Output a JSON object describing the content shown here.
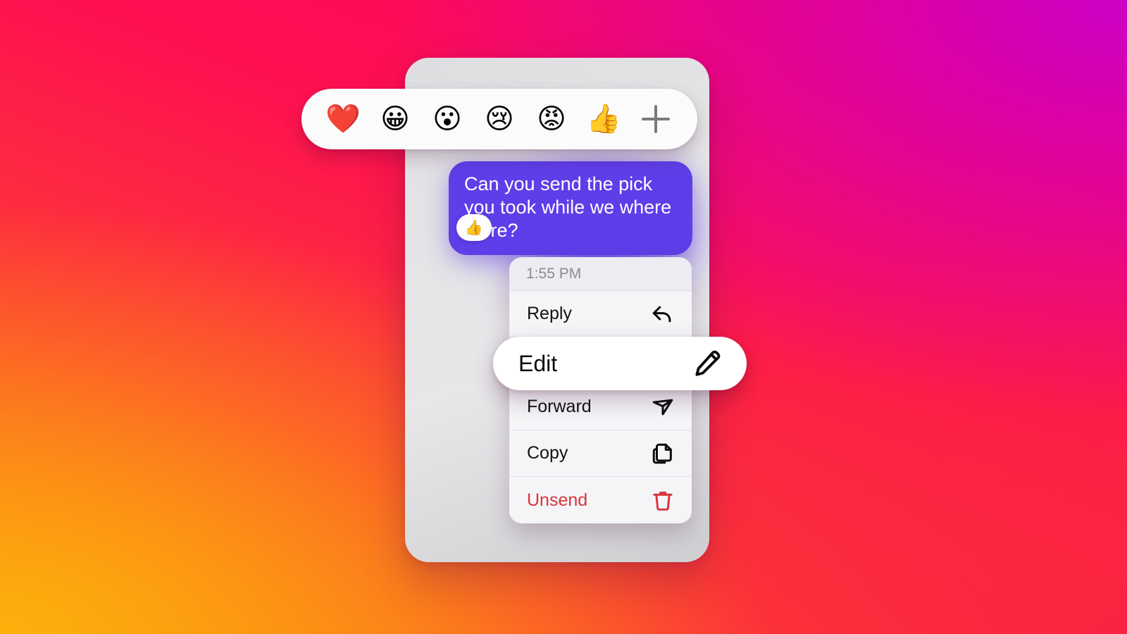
{
  "background": {
    "gradient_colors": [
      "#fc0164",
      "#cc00c4",
      "#fb2440",
      "#fdb00b"
    ]
  },
  "phone_card": {
    "background_color": "#e4e4e6"
  },
  "reaction_bar": {
    "emojis": [
      {
        "name": "heart-emoji",
        "glyph": "❤️",
        "label": "Love"
      },
      {
        "name": "grinning-face-emoji",
        "glyph": "😀",
        "label": "Haha"
      },
      {
        "name": "surprised-face-emoji",
        "glyph": "😮",
        "label": "Wow"
      },
      {
        "name": "crying-face-emoji",
        "glyph": "😢",
        "label": "Sad"
      },
      {
        "name": "angry-face-emoji",
        "glyph": "😡",
        "label": "Angry"
      },
      {
        "name": "thumbs-up-emoji",
        "glyph": "👍",
        "label": "Like"
      }
    ],
    "add_button": {
      "name": "plus-icon",
      "label": "+"
    }
  },
  "message": {
    "text": "Can you send the pick you took while we where there?",
    "bubble_color": "#5e3ee8",
    "text_color": "#ffffff",
    "reaction": {
      "glyph": "👍",
      "name": "thumbs-up-reaction"
    }
  },
  "context_menu": {
    "timestamp": "1:55 PM",
    "items": [
      {
        "label": "Reply",
        "icon": "reply-arrow-icon",
        "destructive": false,
        "highlighted": false
      },
      {
        "label": "Edit",
        "icon": "pencil-icon",
        "destructive": false,
        "highlighted": true
      },
      {
        "label": "Forward",
        "icon": "paper-plane-icon",
        "destructive": false,
        "highlighted": false
      },
      {
        "label": "Copy",
        "icon": "copy-pages-icon",
        "destructive": false,
        "highlighted": false
      },
      {
        "label": "Unsend",
        "icon": "trash-icon",
        "destructive": true,
        "highlighted": false
      }
    ],
    "destructive_color": "#d8343c"
  }
}
